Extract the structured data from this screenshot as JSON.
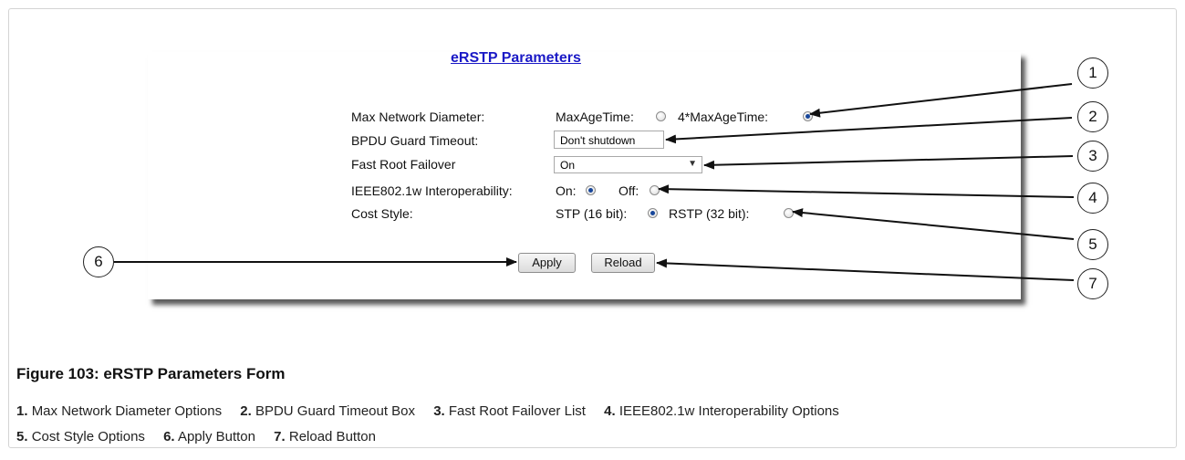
{
  "form": {
    "title": "eRSTP Parameters",
    "rows": [
      {
        "label": "Max Network Diameter:",
        "opt1": "MaxAgeTime:",
        "opt2": "4*MaxAgeTime:",
        "selected": "4*MaxAgeTime:"
      },
      {
        "label": "BPDU Guard Timeout:",
        "value": "Don't shutdown"
      },
      {
        "label": "Fast Root Failover",
        "value": "On"
      },
      {
        "label": "IEEE802.1w Interoperability:",
        "opt1": "On:",
        "opt2": "Off:",
        "selected": "On:"
      },
      {
        "label": "Cost Style:",
        "opt1": "STP (16 bit):",
        "opt2": "RSTP (32 bit):",
        "selected": "STP (16 bit):"
      }
    ],
    "apply_label": "Apply",
    "reload_label": "Reload"
  },
  "callouts": [
    "1",
    "2",
    "3",
    "4",
    "5",
    "6",
    "7"
  ],
  "figure": {
    "caption": "Figure 103: eRSTP Parameters Form",
    "legend": [
      {
        "num": "1.",
        "text": "Max Network Diameter Options"
      },
      {
        "num": "2.",
        "text": "BPDU Guard Timeout Box"
      },
      {
        "num": "3.",
        "text": "Fast Root Failover List"
      },
      {
        "num": "4.",
        "text": "IEEE802.1w Interoperability Options"
      },
      {
        "num": "5.",
        "text": "Cost Style Options"
      },
      {
        "num": "6.",
        "text": "Apply Button"
      },
      {
        "num": "7.",
        "text": "Reload Button"
      }
    ]
  }
}
